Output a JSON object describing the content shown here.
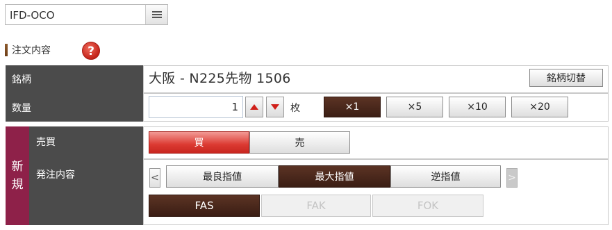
{
  "order_type": {
    "value": "IFD-OCO",
    "menu_icon": "hamburger-menu-icon"
  },
  "section": {
    "title": "注文内容",
    "help_icon": "help-icon",
    "help_glyph": "?"
  },
  "symbol": {
    "label": "銘柄",
    "value": "大阪 - N225先物 1506",
    "change_button": "銘柄切替"
  },
  "quantity": {
    "label": "数量",
    "value": "1",
    "unit": "枚",
    "multipliers": [
      "×1",
      "×5",
      "×10",
      "×20"
    ],
    "selected_multiplier": "×1"
  },
  "new_order": {
    "label_chars": [
      "新",
      "規"
    ],
    "side": {
      "label": "売買",
      "buy": "買",
      "sell": "売",
      "selected": "買"
    },
    "order_content": {
      "label": "発注内容",
      "prev_arrow": "<",
      "next_arrow": ">",
      "order_methods": [
        "最良指値",
        "最大指値",
        "逆指値"
      ],
      "selected_method": "最大指値",
      "conditions": [
        "FAS",
        "FAK",
        "FOK"
      ],
      "selected_condition": "FAS"
    }
  },
  "colors": {
    "label_bg": "#4b4b4b",
    "new_label_bg": "#8e2149",
    "selected_dark": "#3b1e14",
    "buy_red": "#dc3a32",
    "help_red": "#c4241a"
  }
}
